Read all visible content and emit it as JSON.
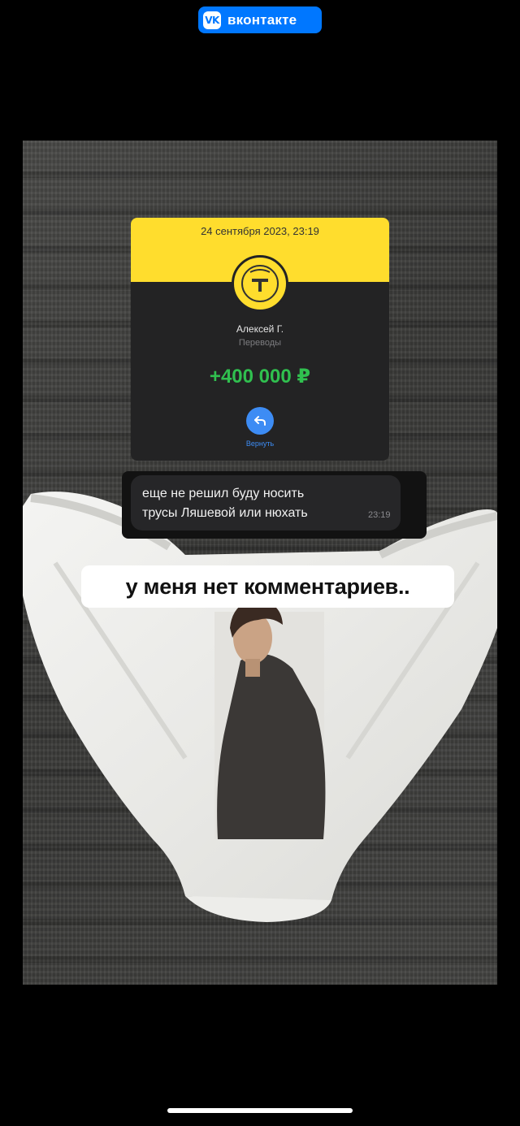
{
  "vk_badge": {
    "logo_text": "VK",
    "name": "вконтакте",
    "color": "#0077ff"
  },
  "receipt": {
    "date": "24 сентября 2023, 23:19",
    "sender_name": "Алексей Г.",
    "category": "Переводы",
    "amount": "+400 000 ₽",
    "return_label": "Вернуть",
    "colors": {
      "brand_yellow": "#ffdd2d",
      "amount_green": "#30c04f",
      "action_blue": "#3d8cf4"
    }
  },
  "message": {
    "line1": "еще не решил буду носить",
    "line2": "трусы Ляшевой или нюхать",
    "time": "23:19"
  },
  "caption": "у меня нет комментариев..",
  "photo": {
    "subject": "white underwear with printed portrait on dark fabric"
  }
}
